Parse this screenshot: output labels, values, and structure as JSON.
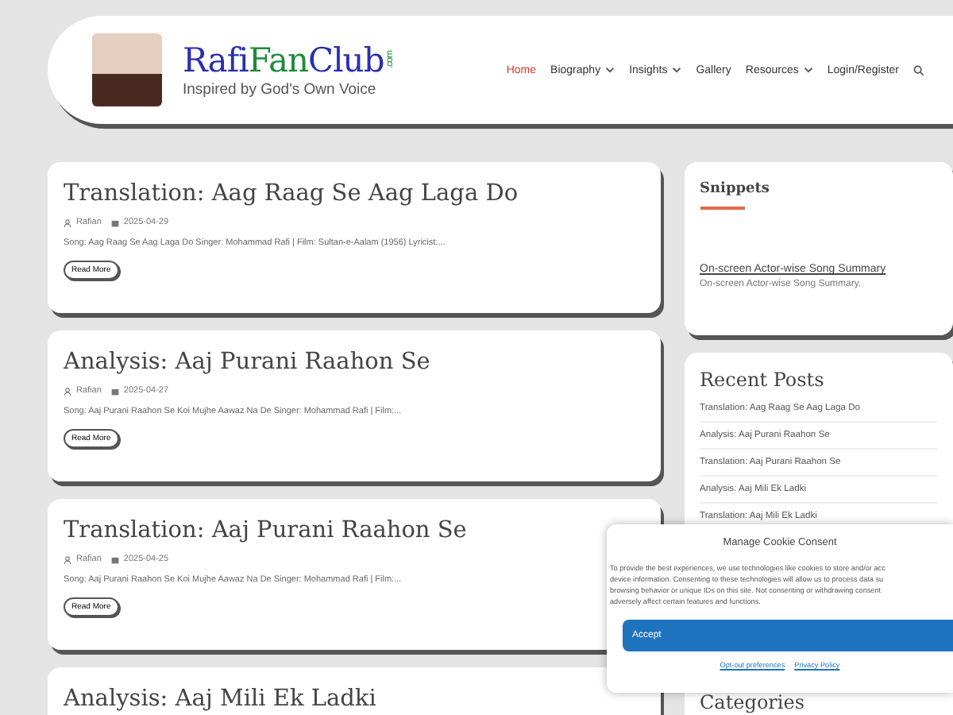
{
  "header": {
    "logo_parts": [
      {
        "text": "Rafi",
        "color": "#2a2fb0"
      },
      {
        "text": "Fan",
        "color": "#1e8a3a"
      },
      {
        "text": "Club",
        "color": "#2a2fb0"
      }
    ],
    "logo_suffix": ".com",
    "tagline": "Inspired by God's Own Voice",
    "nav": [
      {
        "label": "Home",
        "selected": true,
        "dropdown": false
      },
      {
        "label": "Biography",
        "selected": false,
        "dropdown": true
      },
      {
        "label": "Insights",
        "selected": false,
        "dropdown": true
      },
      {
        "label": "Gallery",
        "selected": false,
        "dropdown": false
      },
      {
        "label": "Resources",
        "selected": false,
        "dropdown": true
      },
      {
        "label": "Login/Register",
        "selected": false,
        "dropdown": false
      }
    ]
  },
  "posts": [
    {
      "title": "Translation: Aag Raag Se Aag Laga Do",
      "author": "Rafian",
      "date": "2025-04-29",
      "excerpt": "Song: Aag Raag Se Aag Laga Do Singer: Mohammad Rafi | Film: Sultan-e-Aalam (1956) Lyricist:...",
      "button": "Read More"
    },
    {
      "title": "Analysis: Aaj Purani Raahon Se",
      "author": "Rafian",
      "date": "2025-04-27",
      "excerpt": "Song: Aaj Purani Raahon Se Koi Mujhe Aawaz Na De Singer: Mohammad Rafi | Film:...",
      "button": "Read More"
    },
    {
      "title": "Translation: Aaj Purani Raahon Se",
      "author": "Rafian",
      "date": "2025-04-25",
      "excerpt": "Song: Aaj Purani Raahon Se Koi Mujhe Aawaz Na De Singer: Mohammad Rafi | Film:...",
      "button": "Read More"
    },
    {
      "title": "Analysis: Aaj Mili Ek Ladki"
    }
  ],
  "sidebar": {
    "snippets": {
      "title": "Snippets",
      "link": "On-screen Actor-wise Song Summary",
      "text": "On-screen Actor-wise Song Summary."
    },
    "recent": {
      "title": "Recent Posts",
      "items": [
        "Translation: Aag Raag Se Aag Laga Do",
        "Analysis: Aaj Purani Raahon Se",
        "Translation: Aaj Purani Raahon Se",
        "Analysis: Aaj Mili Ek Ladki",
        "Translation: Aaj Mili Ek Ladki"
      ]
    },
    "categories_title": "Categories"
  },
  "cookie": {
    "title": "Manage Cookie Consent",
    "lines": [
      "To provide the best experiences, we use technologies like cookies to store and/or acc",
      "device information. Consenting to these technologies will allow us to process data su",
      "browsing behavior or unique IDs on this site. Not consenting or withdrawing consent",
      "adversely affect certain features and functions."
    ],
    "accept": "Accept",
    "links": [
      "Opt-out preferences",
      "Privacy Policy"
    ]
  }
}
